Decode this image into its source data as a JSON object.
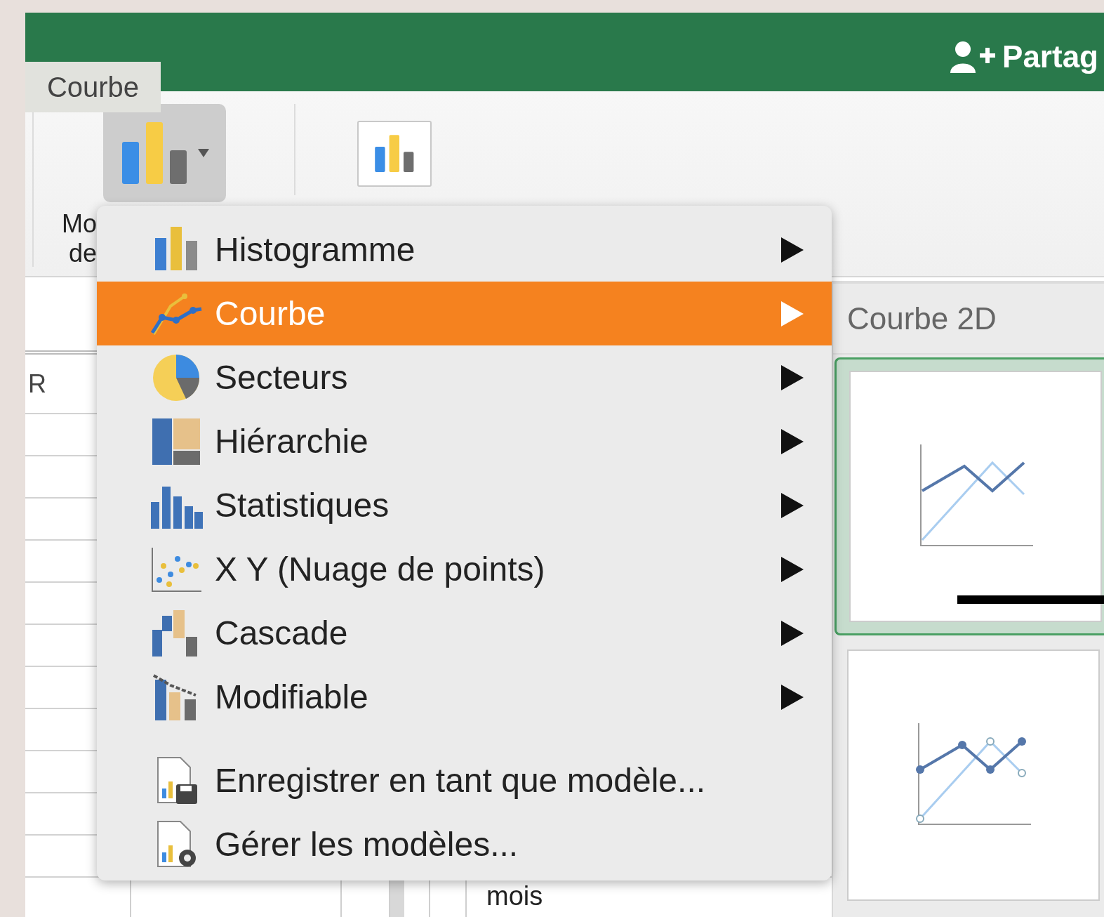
{
  "title_bar": {
    "share_button": "Partag"
  },
  "tooltip": "Courbe",
  "ribbon": {
    "label_lines": [
      "Mo",
      "de"
    ]
  },
  "sheet": {
    "column_header": "R",
    "bottom_cell": "mois"
  },
  "chart_menu": {
    "items": [
      {
        "label": "Histogramme",
        "kind": "column",
        "selected": false,
        "has_submenu": true
      },
      {
        "label": "Courbe",
        "kind": "line",
        "selected": true,
        "has_submenu": true
      },
      {
        "label": "Secteurs",
        "kind": "pie",
        "selected": false,
        "has_submenu": true
      },
      {
        "label": "Hiérarchie",
        "kind": "treemap",
        "selected": false,
        "has_submenu": true
      },
      {
        "label": "Statistiques",
        "kind": "histogram",
        "selected": false,
        "has_submenu": true
      },
      {
        "label": "X Y (Nuage de points)",
        "kind": "scatter",
        "selected": false,
        "has_submenu": true
      },
      {
        "label": "Cascade",
        "kind": "waterfall",
        "selected": false,
        "has_submenu": true
      },
      {
        "label": "Modifiable",
        "kind": "combo",
        "selected": false,
        "has_submenu": true
      }
    ],
    "template_items": [
      {
        "label": "Enregistrer en tant que modèle...",
        "kind": "save"
      },
      {
        "label": "Gérer les modèles...",
        "kind": "manage"
      }
    ]
  },
  "submenu": {
    "title": "Courbe 2D",
    "thumbnails": [
      {
        "kind": "line",
        "selected": true
      },
      {
        "kind": "line_markers",
        "selected": false
      }
    ]
  }
}
